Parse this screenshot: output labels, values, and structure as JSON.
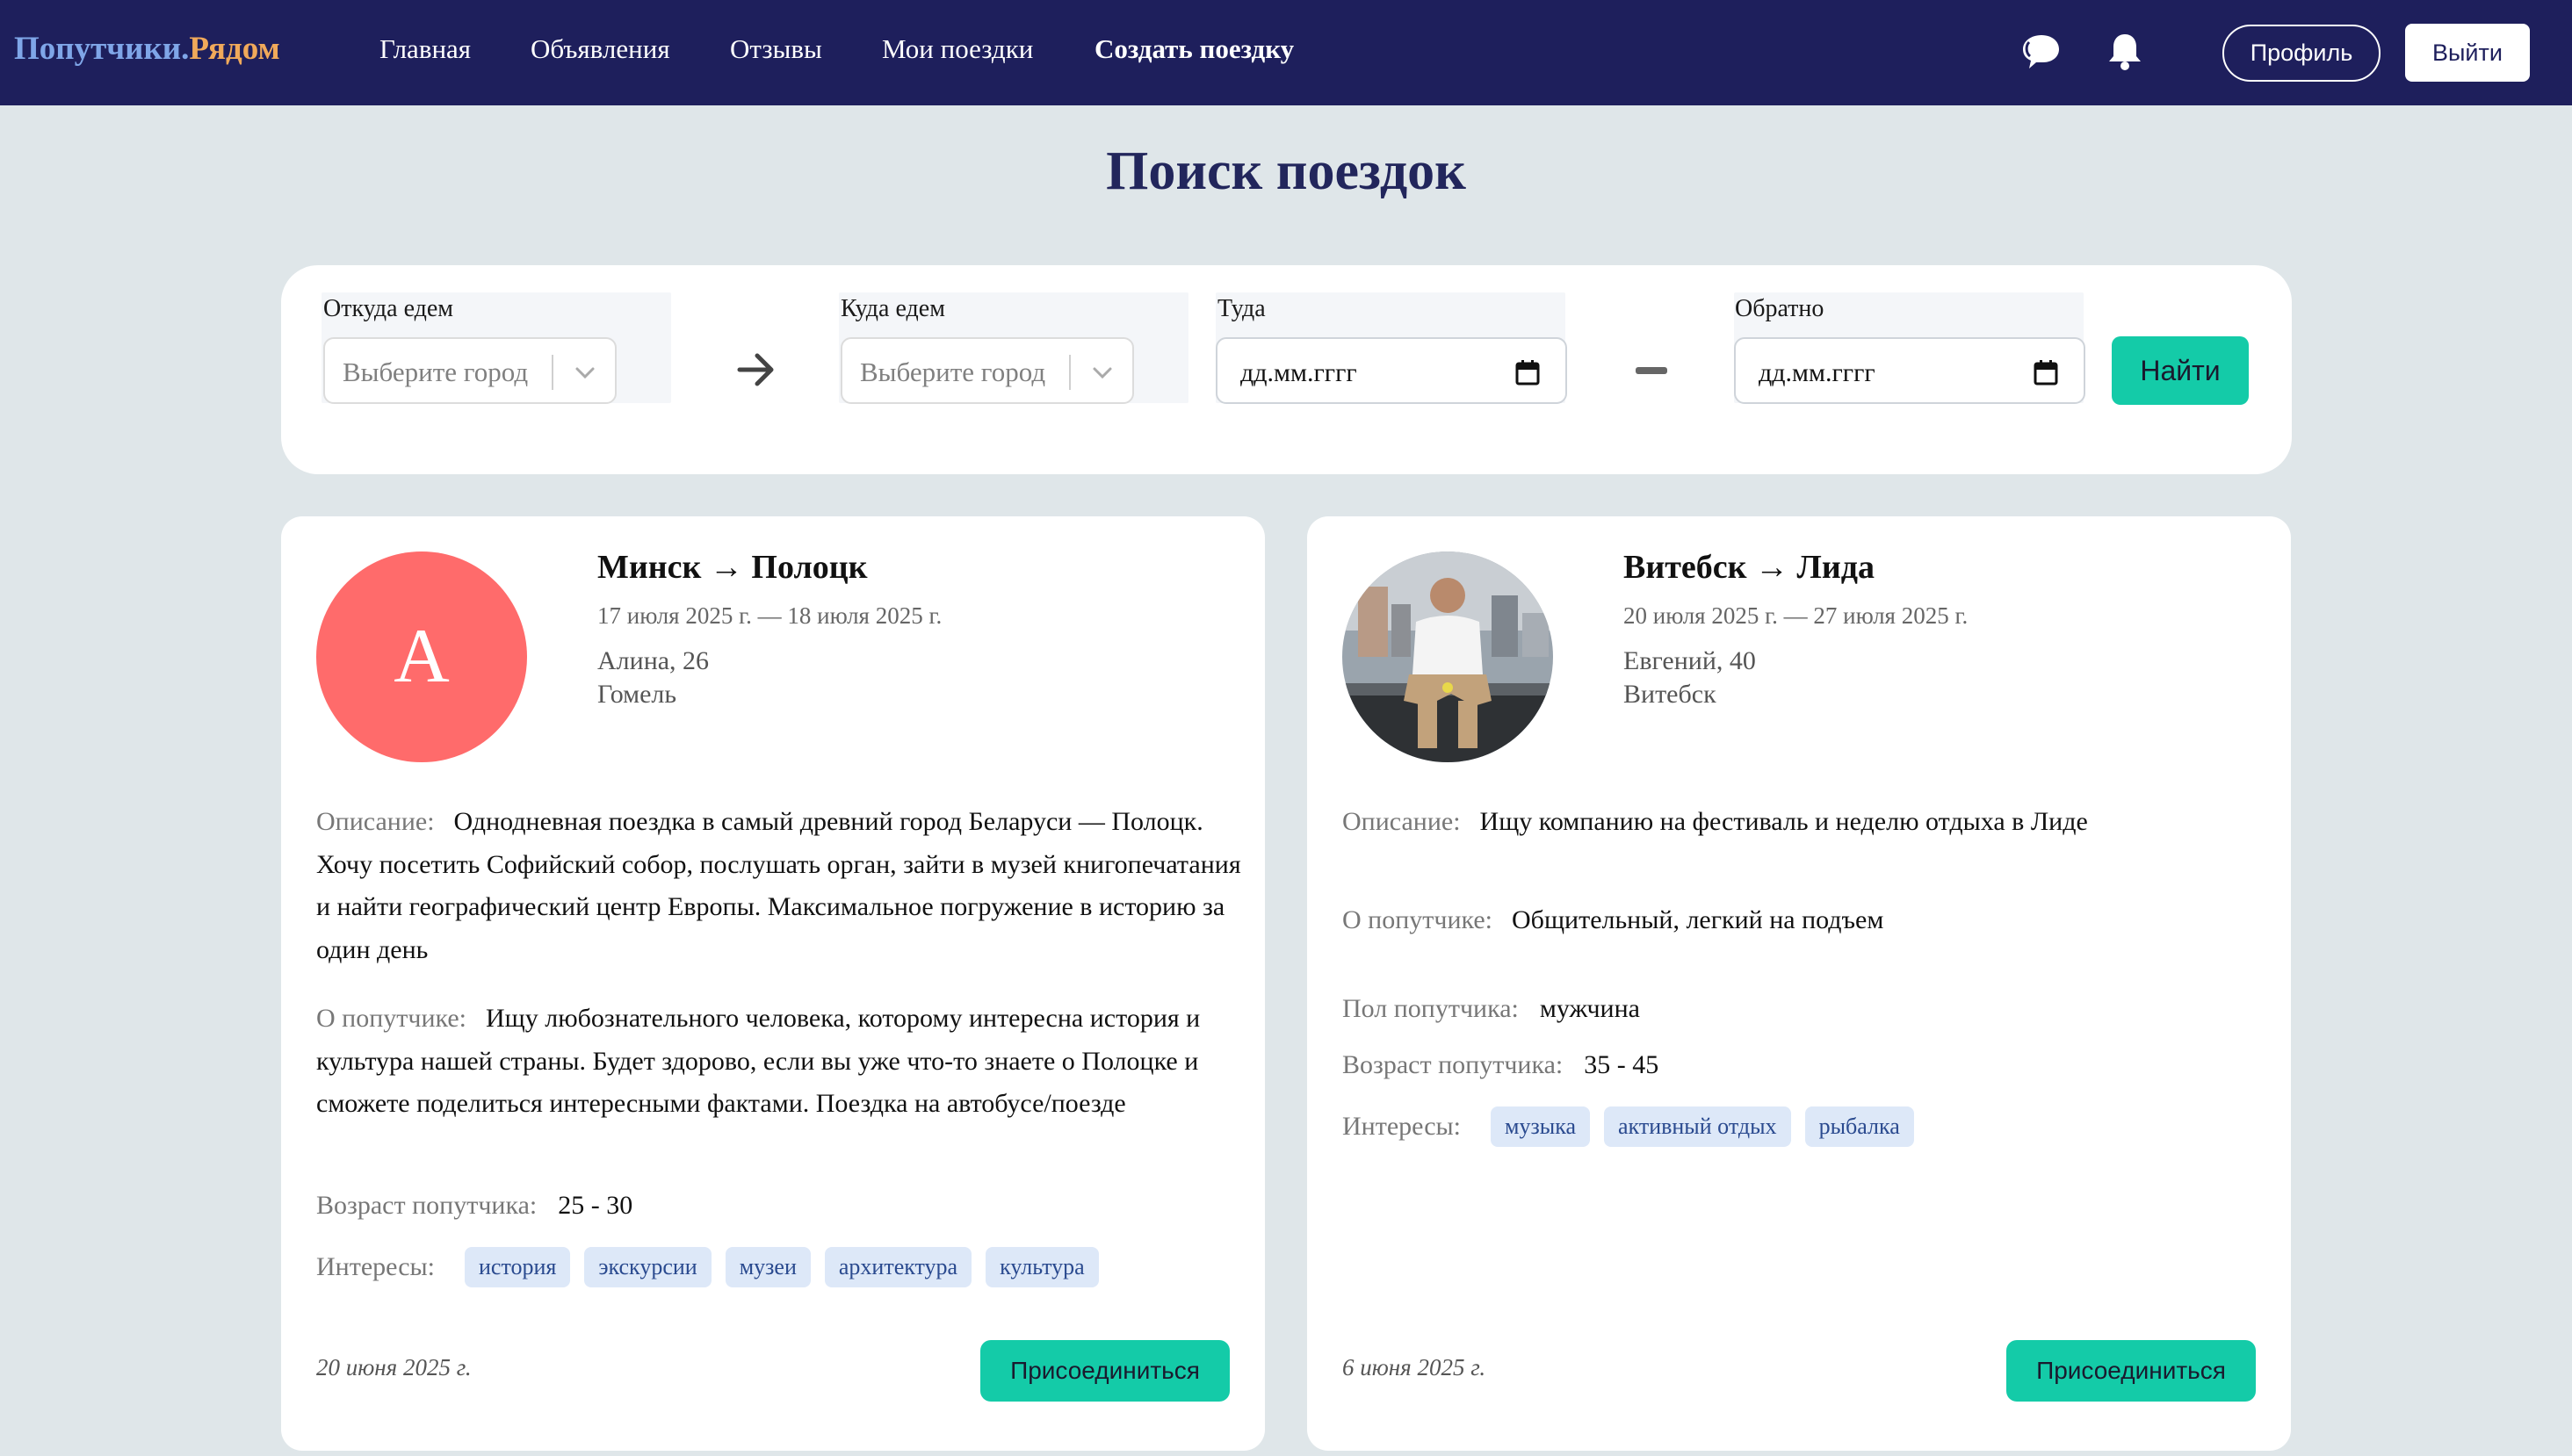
{
  "nav": {
    "logo_part1": "Попутчики.",
    "logo_part2": "Рядом",
    "links": [
      "Главная",
      "Объявления",
      "Отзывы",
      "Мои поездки",
      "Создать поездку"
    ],
    "profile_label": "Профиль",
    "logout_label": "Выйти",
    "icons": [
      "chat-icon",
      "bell-icon"
    ]
  },
  "page_title": "Поиск поездок",
  "search": {
    "from_label": "Откуда едем",
    "from_placeholder": "Выберите город",
    "to_label": "Куда едем",
    "to_placeholder": "Выберите город",
    "there_label": "Туда",
    "there_placeholder": "дд.мм.гггг",
    "back_label": "Обратно",
    "back_placeholder": "дд.мм.гггг",
    "find_label": "Найти"
  },
  "trips": [
    {
      "avatar_letter": "А",
      "route": "Минск → Полоцк",
      "dates": "17 июля 2025 г. — 18 июля 2025 г.",
      "person": "Алина, 26",
      "city": "Гомель",
      "description_label": "Описание:",
      "description": "Однодневная поездка в самый древний город Беларуси — Полоцк. Хочу посетить Софийский собор, послушать орган, зайти в музей книгопечатания и найти географический центр Европы. Максимальное погружение в историю за один день",
      "about_label": "О попутчике:",
      "about": "Ищу любознательного человека, которому интересна история и культура нашей страны. Будет здорово, если вы уже что-то знаете о Полоцке и сможете поделиться интересными фактами. Поездка на автобусе/поезде",
      "age_label": "Возраст попутчика:",
      "age": "25 - 30",
      "interests_label": "Интересы:",
      "interests": [
        "история",
        "экскурсии",
        "музеи",
        "архитектура",
        "культура"
      ],
      "posted": "20 июня 2025 г.",
      "join_label": "Присоединиться"
    },
    {
      "route": "Витебск → Лида",
      "dates": "20 июля 2025 г. — 27 июля 2025 г.",
      "person": "Евгений, 40",
      "city": "Витебск",
      "description_label": "Описание:",
      "description": "Ищу компанию на фестиваль и неделю отдыха в Лиде",
      "about_label": "О попутчике:",
      "about": "Общительный, легкий на подъем",
      "gender_label": "Пол попутчика:",
      "gender": "мужчина",
      "age_label": "Возраст попутчика:",
      "age": "35 - 45",
      "interests_label": "Интересы:",
      "interests": [
        "музыка",
        "активный отдых",
        "рыбалка"
      ],
      "posted": "6 июня 2025 г.",
      "join_label": "Присоединиться"
    }
  ],
  "colors": {
    "nav_bg": "#1e1f5c",
    "accent": "#14cba8",
    "page_bg": "#dfe6e9",
    "avatar_bg": "#ff6b6b",
    "tag_bg": "#dde8f8"
  }
}
